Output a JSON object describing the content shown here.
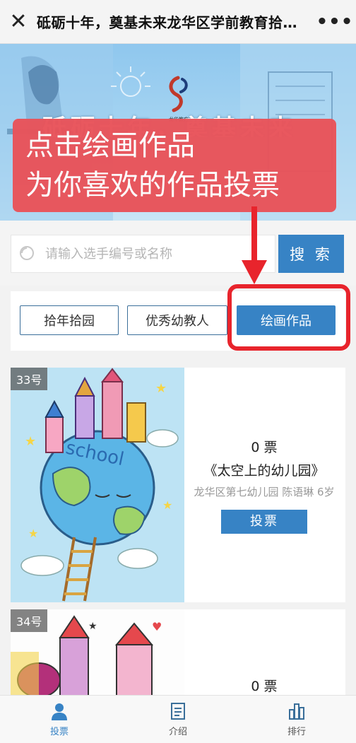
{
  "navbar": {
    "title": "砥砺十年，奠基未来龙华区学前教育拾…",
    "close_icon": "close-icon",
    "more_icon": "more-icon"
  },
  "banner": {
    "title": "砥砺十年，奠基未来",
    "logo_text": "龙华教育"
  },
  "overlay": {
    "line1": "点击绘画作品",
    "line2": "为你喜欢的作品投票"
  },
  "search": {
    "placeholder": "请输入选手编号或名称",
    "button_label": "搜 索"
  },
  "tabs": [
    {
      "label": "拾年拾园",
      "active": false
    },
    {
      "label": "优秀幼教人",
      "active": false
    },
    {
      "label": "绘画作品",
      "active": true
    }
  ],
  "works": [
    {
      "number": "33号",
      "votes": "0 票",
      "title": "《太空上的幼儿园》",
      "meta": "龙华区第七幼儿园 陈语琳 6岁",
      "vote_label": "投票",
      "drawing_text": "school"
    },
    {
      "number": "34号",
      "votes": "0 票"
    }
  ],
  "tabbar": [
    {
      "label": "投票",
      "icon": "person-icon",
      "active": true
    },
    {
      "label": "介绍",
      "icon": "document-icon",
      "active": false
    },
    {
      "label": "排行",
      "icon": "bar-chart-icon",
      "active": false
    }
  ],
  "colors": {
    "accent": "#3783c5",
    "overlay_red": "#e9535a",
    "highlight_red": "#e8242c"
  }
}
